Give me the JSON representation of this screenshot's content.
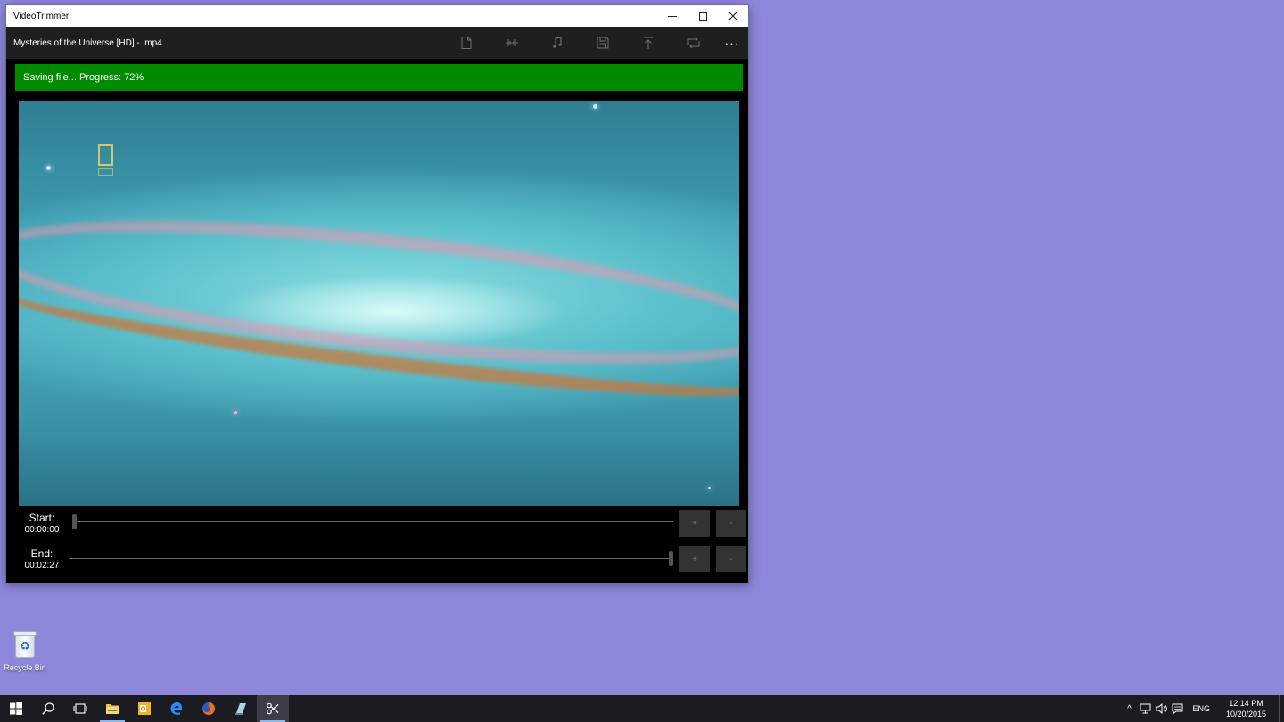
{
  "window": {
    "title": "VideoTrimmer",
    "file_name": "Mysteries of the Universe [HD] - .mp4",
    "controls": {
      "minimize": "minimize",
      "maximize": "maximize",
      "close": "close"
    }
  },
  "toolbar": {
    "tools": [
      {
        "icon": "open-file-icon"
      },
      {
        "icon": "trim-icon"
      },
      {
        "icon": "music-icon"
      },
      {
        "icon": "save-icon"
      },
      {
        "icon": "share-icon"
      },
      {
        "icon": "repeat-icon"
      }
    ],
    "more_label": "···"
  },
  "status": {
    "text": "Saving file... Progress: 72%",
    "progress_percent": 72,
    "color": "#008a00"
  },
  "trim": {
    "start": {
      "label": "Start:",
      "time": "00:00:00",
      "position_fraction": 0.0,
      "plus": "+",
      "minus": "-"
    },
    "end": {
      "label": "End:",
      "time": "00:02:27",
      "position_fraction": 1.0,
      "plus": "+",
      "minus": "-"
    }
  },
  "desktop": {
    "background": "#8e88dc",
    "icons": [
      {
        "label": "Recycle Bin",
        "icon": "recycle-bin-icon"
      }
    ]
  },
  "taskbar": {
    "items": [
      {
        "icon": "windows-start-icon"
      },
      {
        "icon": "search-icon"
      },
      {
        "icon": "task-view-icon"
      },
      {
        "icon": "file-explorer-icon"
      },
      {
        "icon": "outlook-icon"
      },
      {
        "icon": "edge-icon"
      },
      {
        "icon": "firefox-icon"
      },
      {
        "icon": "app-icon"
      },
      {
        "icon": "videotrimmer-icon"
      }
    ],
    "tray": {
      "chevron": "^",
      "language": "ENG",
      "time": "12:14 PM",
      "date": "10/20/2015"
    }
  }
}
